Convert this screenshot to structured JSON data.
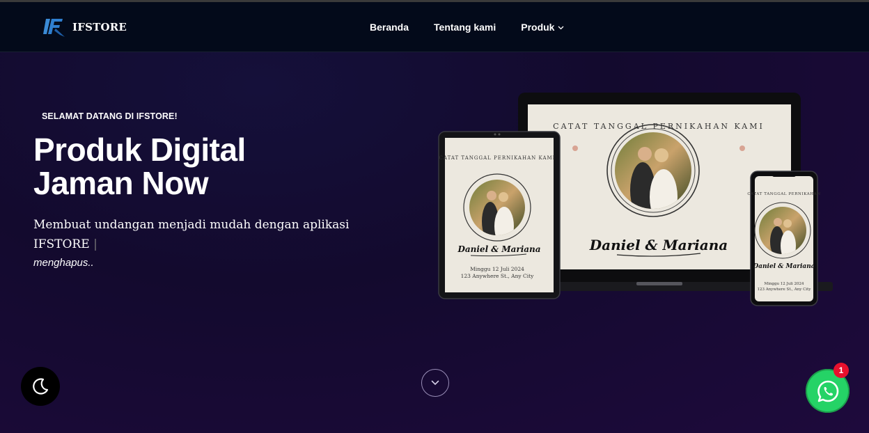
{
  "header": {
    "brand": "IFSTORE",
    "nav": [
      {
        "label": "Beranda"
      },
      {
        "label": "Tentang kami"
      },
      {
        "label": "Produk"
      }
    ]
  },
  "hero": {
    "welcome": "SELAMAT DATANG DI IFSTORE!",
    "title_line1": "Produk Digital",
    "title_line2": "Jaman Now",
    "description": "Membuat undangan menjadi mudah dengan aplikasi IFSTORE",
    "cursor": "|",
    "typing": "menghapus.."
  },
  "mockup": {
    "laptop_arc": "CATAT TANGGAL PERNIKAHAN KAMI",
    "arc_small": "CATAT TANGGAL PERNIKAHAN KAMI",
    "phone_arc": "CATAT TANGGAL PERNIKAHAN",
    "names": "Daniel & Mariana",
    "date": "Minggu 12 Juli 2024",
    "address": "123 Anywhere St., Any City"
  },
  "whatsapp": {
    "badge": "1"
  },
  "colors": {
    "accent": "#25d366",
    "badge": "#e8112d",
    "header_bg": "#030a1a"
  }
}
